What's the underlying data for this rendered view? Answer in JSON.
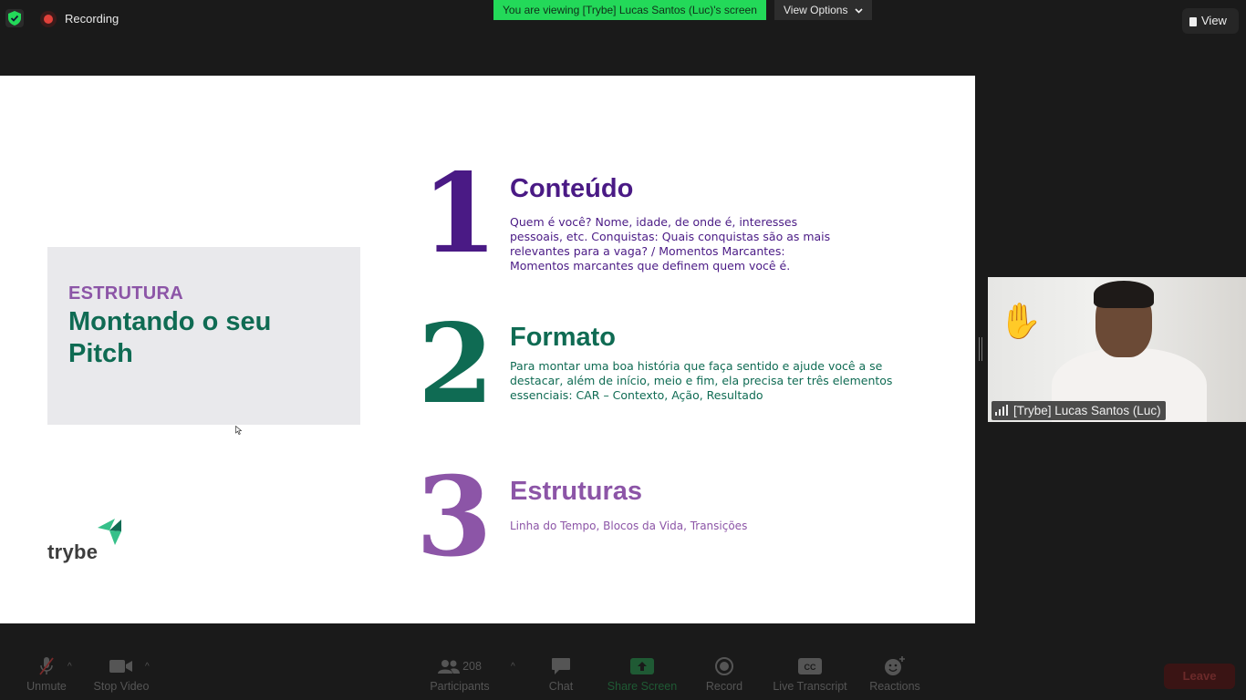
{
  "topbar": {
    "recording_label": "Recording",
    "viewing_banner": "You are viewing [Trybe] Lucas Santos (Luc)'s screen",
    "view_options_label": "View Options",
    "view_label": "View"
  },
  "slide": {
    "card": {
      "kicker": "ESTRUTURA",
      "title": "Montando o seu Pitch"
    },
    "logo_text": "trybe",
    "sections": [
      {
        "number": "1",
        "title": "Conteúdo",
        "body": "Quem é você? Nome, idade, de onde é, interesses pessoais, etc. Conquistas: Quais conquistas são as mais relevantes para a vaga? / Momentos Marcantes: Momentos marcantes que definem quem você é."
      },
      {
        "number": "2",
        "title": "Formato",
        "body": "Para montar uma boa história que faça sentido e ajude você a se destacar, além de início, meio e fim, ela precisa ter três elementos essenciais: CAR – Contexto, Ação, Resultado"
      },
      {
        "number": "3",
        "title": "Estruturas",
        "body": "Linha do Tempo, Blocos da Vida, Transições"
      }
    ],
    "colors": {
      "purple": "#4a1a85",
      "green": "#0f6b53",
      "lilac": "#8c55a7"
    }
  },
  "video": {
    "participant_name": "[Trybe] Lucas Santos (Luc)",
    "reaction_icon": "raised-hand-icon"
  },
  "toolbar": {
    "unmute": "Unmute",
    "stop_video": "Stop Video",
    "participants_count": "208",
    "participants": "Participants",
    "chat": "Chat",
    "share_screen": "Share Screen",
    "record": "Record",
    "live_transcript": "Live Transcript",
    "reactions": "Reactions",
    "leave": "Leave"
  }
}
